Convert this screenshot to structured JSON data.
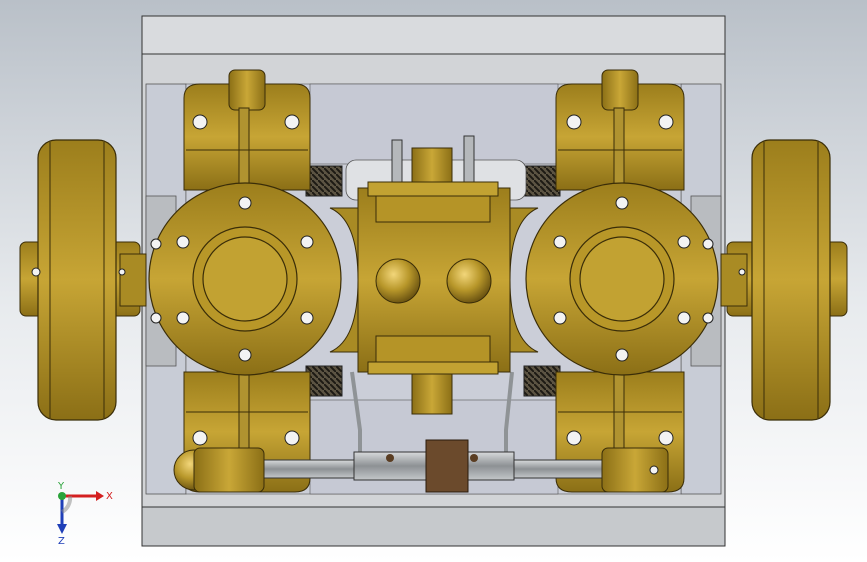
{
  "viewport": {
    "background_top": "#b9c0c8",
    "background_bottom": "#ffffff"
  },
  "colors": {
    "brass": "#b8972a",
    "brass_dark": "#6e5612",
    "frame_steel": "#d3d5d8",
    "frame_shadow": "#9ea3a9",
    "steel_rod": "#a8acb0",
    "spring": "#3a352a",
    "bronze": "#6b4a2c"
  },
  "triad": {
    "x_label": "X",
    "y_label": "Y",
    "z_label": "Z",
    "icon": "coordinate-triad-icon"
  }
}
